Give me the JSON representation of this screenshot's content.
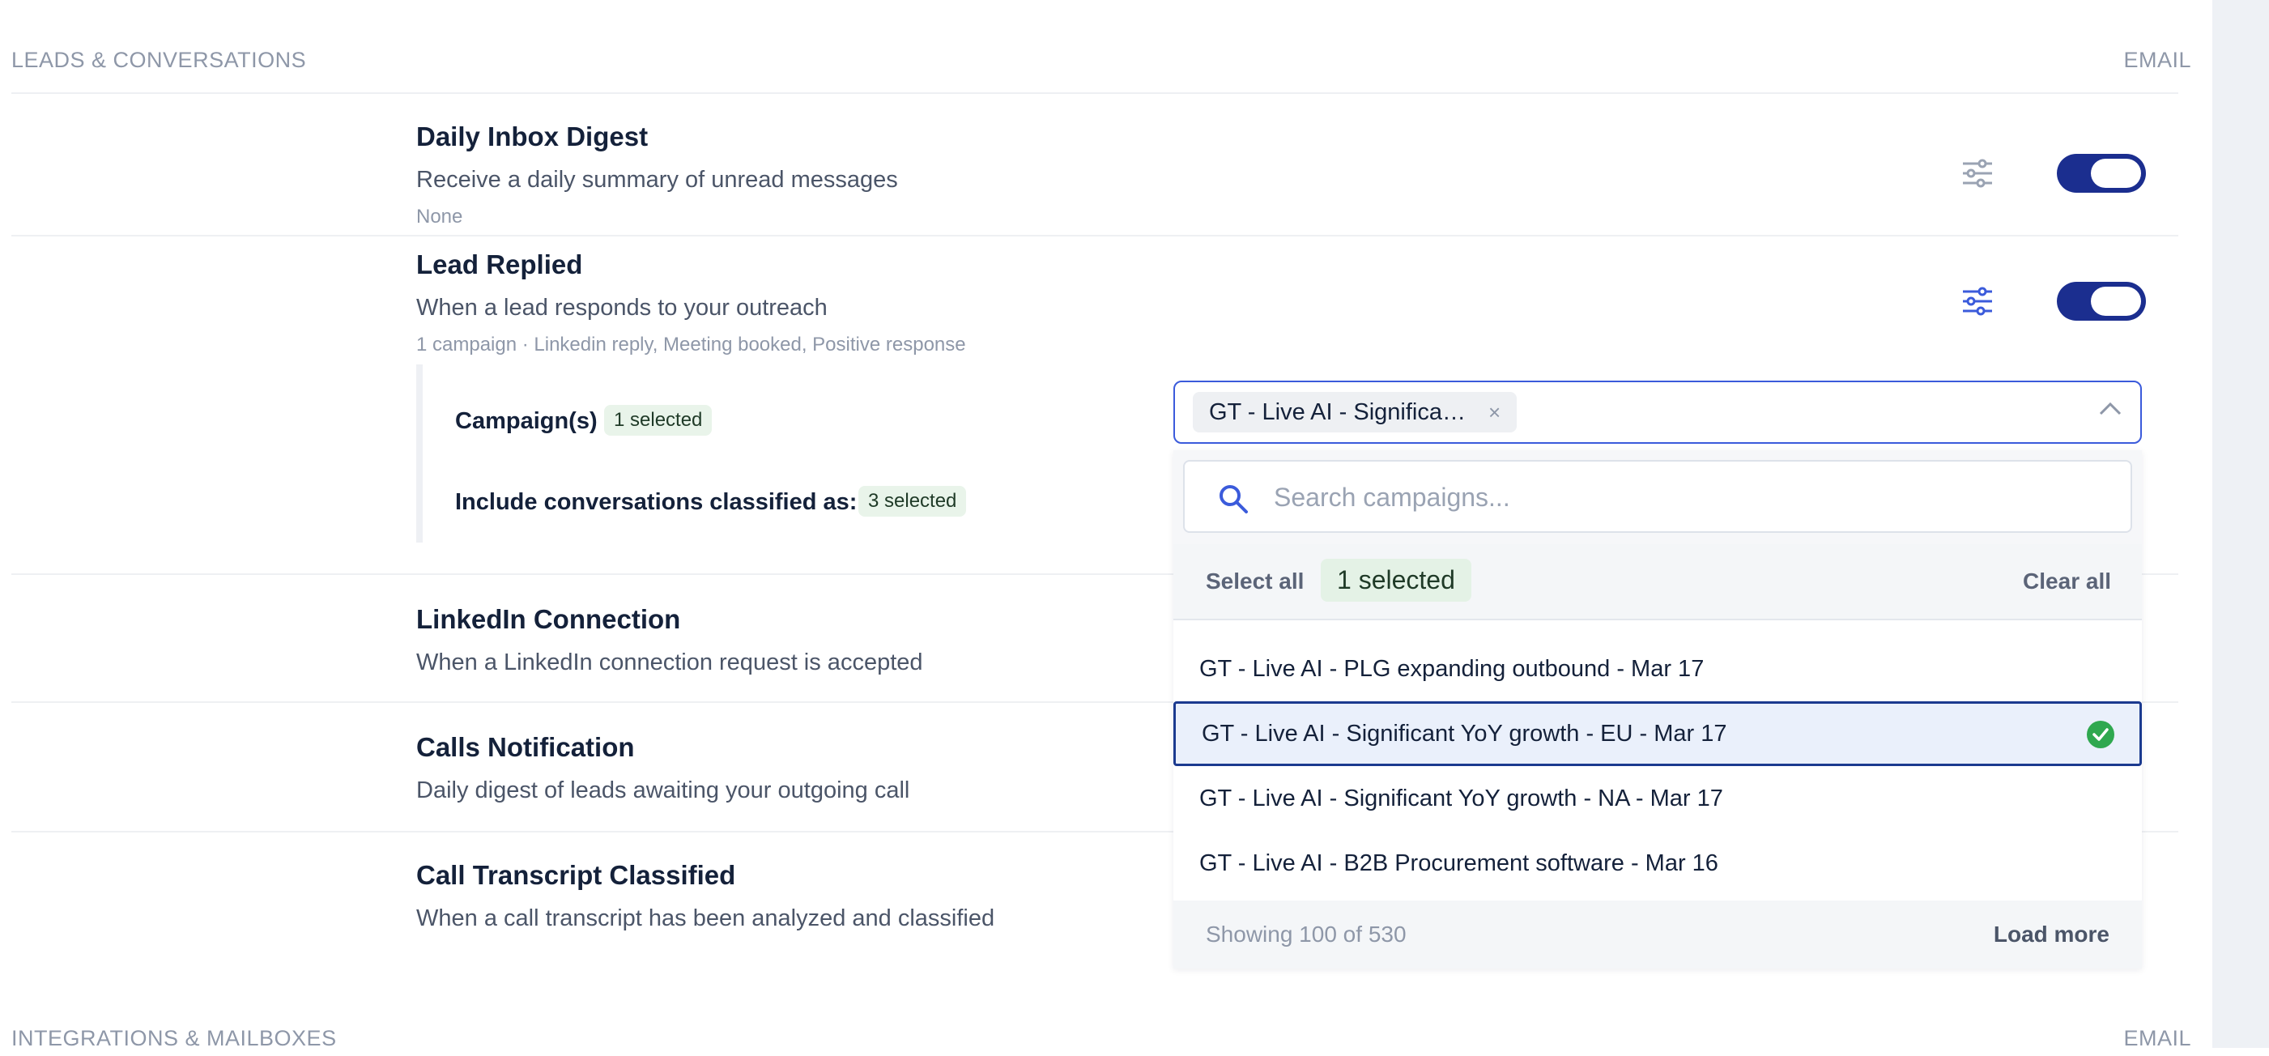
{
  "sections": {
    "leads": {
      "title": "LEADS & CONVERSATIONS",
      "channel": "EMAIL"
    },
    "integrations": {
      "title": "INTEGRATIONS & MAILBOXES",
      "channel": "EMAIL"
    }
  },
  "rows": {
    "daily_digest": {
      "title": "Daily Inbox Digest",
      "desc": "Receive a daily summary of unread messages",
      "meta": "None",
      "enabled": true
    },
    "lead_replied": {
      "title": "Lead Replied",
      "desc": "When a lead responds to your outreach",
      "meta": "1 campaign · Linkedin reply, Meeting booked, Positive response",
      "enabled": true
    },
    "linkedin_connection": {
      "title": "LinkedIn Connection",
      "desc": "When a LinkedIn connection request is accepted"
    },
    "calls_notification": {
      "title": "Calls Notification",
      "desc": "Daily digest of leads awaiting your outgoing call"
    },
    "call_transcript": {
      "title": "Call Transcript Classified",
      "desc": "When a call transcript has been analyzed and classified"
    }
  },
  "config": {
    "campaigns_label": "Campaign(s)",
    "campaigns_badge": "1 selected",
    "classified_label": "Include conversations classified as:",
    "classified_badge": "3 selected"
  },
  "select": {
    "chip_label": "GT - Live AI - Significa…",
    "chip_remove": "×"
  },
  "dropdown": {
    "search_placeholder": "Search campaigns...",
    "select_all": "Select all",
    "selected_badge": "1 selected",
    "clear_all": "Clear all",
    "options": [
      {
        "label": "GT - Live AI - PLG expanding outbound - Mar 17",
        "selected": false
      },
      {
        "label": "GT - Live AI - Significant YoY growth - EU - Mar 17",
        "selected": true
      },
      {
        "label": "GT - Live AI - Significant YoY growth - NA - Mar 17",
        "selected": false
      },
      {
        "label": "GT - Live AI - B2B Procurement software - Mar 16",
        "selected": false
      }
    ],
    "showing": "Showing 100 of 530",
    "load_more": "Load more"
  },
  "colors": {
    "accent": "#1b2e8f",
    "focus": "#3b5bdb",
    "success": "#2fa84f",
    "muted": "#8e97a8"
  },
  "icons": {
    "settings": "sliders-icon",
    "search": "search-icon",
    "check": "check-circle-icon",
    "chevron": "chevron-up-icon"
  }
}
